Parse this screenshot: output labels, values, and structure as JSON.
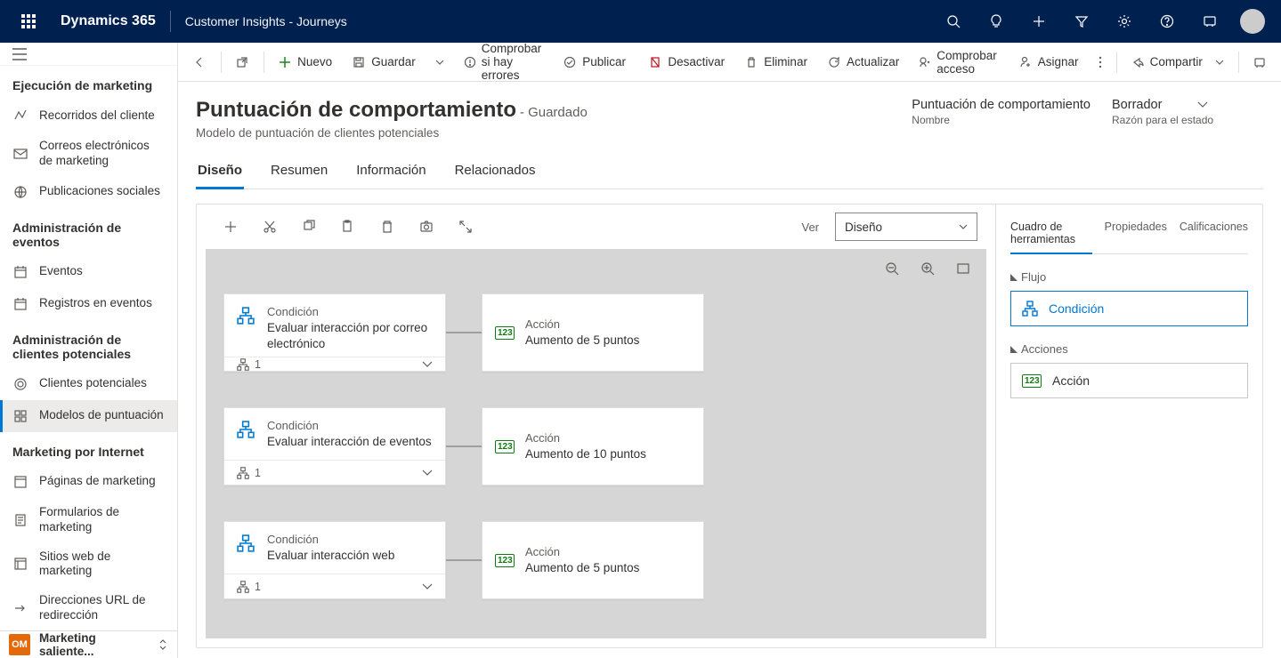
{
  "topbar": {
    "brand": "Dynamics 365",
    "app": "Customer Insights - Journeys"
  },
  "nav": {
    "sections": [
      {
        "title": "Ejecución de marketing",
        "items": [
          {
            "label": "Recorridos del cliente"
          },
          {
            "label": "Correos electrónicos de marketing"
          },
          {
            "label": "Publicaciones sociales"
          }
        ]
      },
      {
        "title": "Administración de eventos",
        "items": [
          {
            "label": "Eventos"
          },
          {
            "label": "Registros en eventos"
          }
        ]
      },
      {
        "title": "Administración de clientes potenciales",
        "items": [
          {
            "label": "Clientes potenciales"
          },
          {
            "label": "Modelos de puntuación",
            "active": true
          }
        ]
      },
      {
        "title": "Marketing por Internet",
        "items": [
          {
            "label": "Páginas de marketing"
          },
          {
            "label": "Formularios de marketing"
          },
          {
            "label": "Sitios web de marketing"
          },
          {
            "label": "Direcciones URL de redirección"
          }
        ]
      }
    ],
    "appSwitcher": {
      "badge": "OM",
      "label": "Marketing saliente..."
    }
  },
  "commands": {
    "new": "Nuevo",
    "save": "Guardar",
    "check": "Comprobar si hay errores",
    "golive": "Publicar",
    "deactivate": "Desactivar",
    "delete": "Eliminar",
    "refresh": "Actualizar",
    "checkaccess": "Comprobar acceso",
    "assign": "Asignar",
    "share": "Compartir"
  },
  "record": {
    "title": "Puntuación de comportamiento",
    "status": "- Guardado",
    "entity": "Modelo de puntuación de clientes potenciales",
    "meta": [
      {
        "value": "Puntuación de comportamiento",
        "label": "Nombre"
      },
      {
        "value": "Borrador",
        "label": "Razón para el estado"
      }
    ],
    "tabs": [
      "Diseño",
      "Resumen",
      "Información",
      "Relacionados"
    ],
    "activeTab": 0
  },
  "designer": {
    "viewLabel": "Ver",
    "viewValue": "Diseño",
    "rows": [
      {
        "condTitle": "Condición",
        "condDesc": "Evaluar interacción por correo electrónico",
        "count": "1",
        "actTitle": "Acción",
        "actDesc": "Aumento de 5 puntos"
      },
      {
        "condTitle": "Condición",
        "condDesc": "Evaluar interacción de eventos",
        "count": "1",
        "actTitle": "Acción",
        "actDesc": "Aumento de 10 puntos"
      },
      {
        "condTitle": "Condición",
        "condDesc": "Evaluar interacción web",
        "count": "1",
        "actTitle": "Acción",
        "actDesc": "Aumento de 5 puntos"
      }
    ],
    "panel": {
      "tabs": [
        "Cuadro de herramientas",
        "Propiedades",
        "Calificaciones"
      ],
      "activeTab": 0,
      "flowLabel": "Flujo",
      "condLabel": "Condición",
      "actionsLabel": "Acciones",
      "actionLabel": "Acción"
    }
  }
}
